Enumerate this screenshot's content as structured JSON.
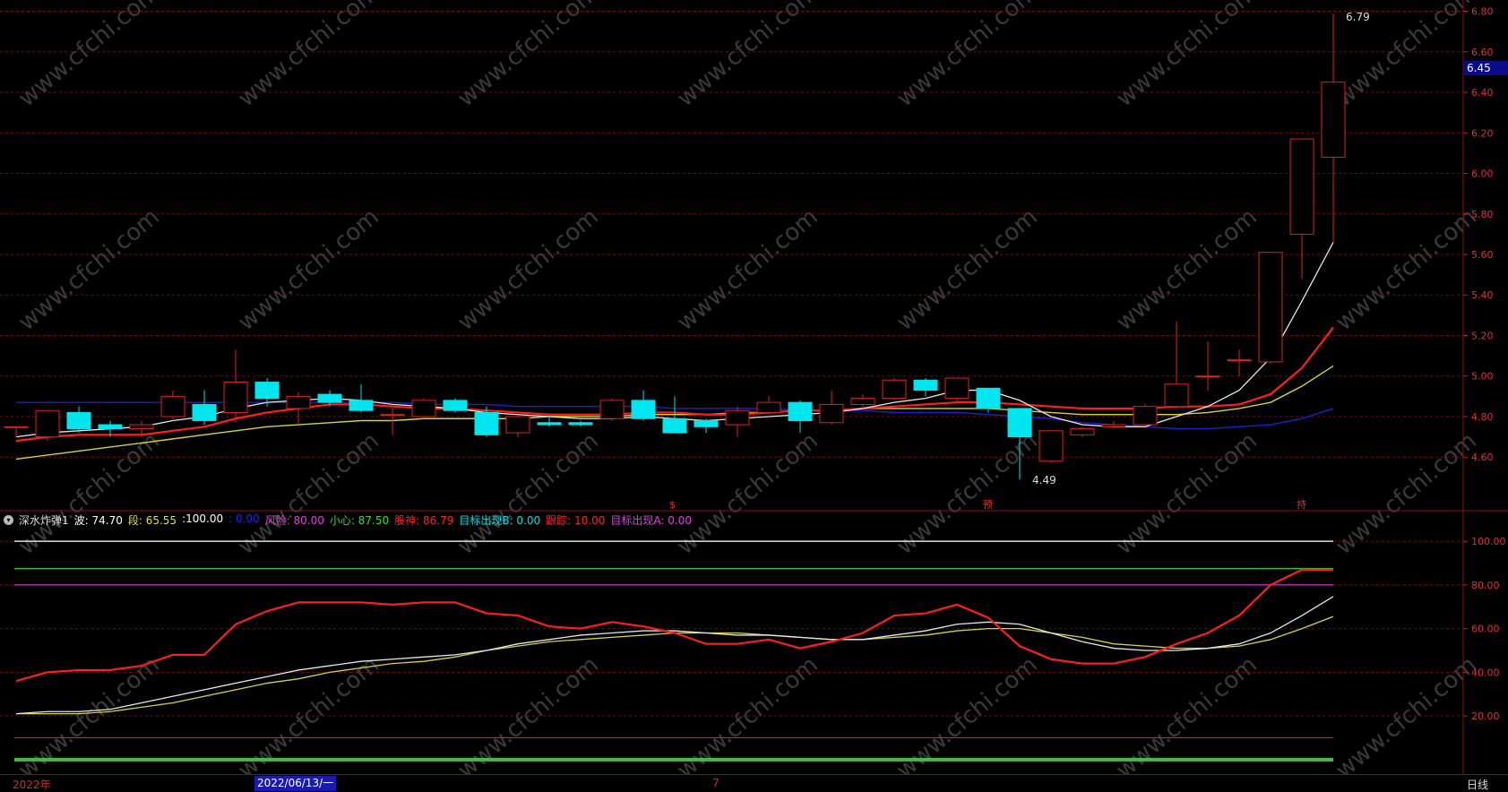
{
  "colors": {
    "up": "#e02020",
    "down": "#00e5ee",
    "ma_white": "#e6e6e6",
    "ma_red": "#ff1e1e",
    "ma_yellow": "#d6d62a",
    "ma_blue": "#2020d0",
    "grid": "#6e0f0f",
    "axis_text": "#e03030",
    "watermark": "#3a3a3a"
  },
  "watermark_text": "www.cfchi.com",
  "price_axis": {
    "ticks": [
      "6.80",
      "6.60",
      "6.40",
      "6.20",
      "6.00",
      "5.80",
      "5.60",
      "5.40",
      "5.20",
      "5.00",
      "4.80",
      "4.60"
    ],
    "range": [
      4.38,
      6.82
    ],
    "current_price": "6.45"
  },
  "annotations": {
    "high_label": "6.79",
    "low_label": "4.49",
    "signals": [
      "$",
      "预",
      "持"
    ]
  },
  "indicator_legend": {
    "name": "深水炸弹1",
    "items": [
      {
        "label": "波:",
        "value": "74.70",
        "color": "#ffffff"
      },
      {
        "label": "段:",
        "value": "65.55",
        "color": "#e0e040"
      },
      {
        "label": "",
        "value": ":100.00",
        "color": "#ffffff"
      },
      {
        "label": "",
        "value": ": 0.00",
        "color": "#2020ff"
      },
      {
        "label": "风险:",
        "value": "80.00",
        "color": "#e040e0"
      },
      {
        "label": "小心:",
        "value": "87.50",
        "color": "#30e030"
      },
      {
        "label": "股神:",
        "value": "86.79",
        "color": "#ff2020"
      },
      {
        "label": "目标出现B:",
        "value": "0.00",
        "color": "#00e0e0"
      },
      {
        "label": "跟踪:",
        "value": "10.00",
        "color": "#ff2020"
      },
      {
        "label": "目标出现A:",
        "value": "0.00",
        "color": "#e040e0"
      }
    ]
  },
  "indicator_axis": {
    "ticks": [
      "100.00",
      "80.00",
      "60.00",
      "40.00",
      "20.00"
    ],
    "range": [
      -5,
      105
    ]
  },
  "bottom_bar": {
    "year": "2022年",
    "date": "2022/06/13/一",
    "mark": "7",
    "period": "日线"
  },
  "chart_data": {
    "type": "candlestick",
    "candles": [
      {
        "o": 4.75,
        "c": 4.75,
        "h": 4.75,
        "l": 4.7
      },
      {
        "o": 4.7,
        "c": 4.83,
        "h": 4.83,
        "l": 4.68
      },
      {
        "o": 4.82,
        "c": 4.74,
        "h": 4.85,
        "l": 4.72
      },
      {
        "o": 4.76,
        "c": 4.74,
        "h": 4.78,
        "l": 4.7
      },
      {
        "o": 4.74,
        "c": 4.76,
        "h": 4.78,
        "l": 4.7
      },
      {
        "o": 4.8,
        "c": 4.9,
        "h": 4.93,
        "l": 4.78
      },
      {
        "o": 4.86,
        "c": 4.78,
        "h": 4.93,
        "l": 4.76
      },
      {
        "o": 4.82,
        "c": 4.97,
        "h": 5.13,
        "l": 4.77
      },
      {
        "o": 4.97,
        "c": 4.89,
        "h": 4.99,
        "l": 4.85
      },
      {
        "o": 4.84,
        "c": 4.9,
        "h": 4.92,
        "l": 4.76
      },
      {
        "o": 4.91,
        "c": 4.87,
        "h": 4.93,
        "l": 4.85
      },
      {
        "o": 4.88,
        "c": 4.83,
        "h": 4.96,
        "l": 4.82
      },
      {
        "o": 4.81,
        "c": 4.81,
        "h": 4.84,
        "l": 4.71
      },
      {
        "o": 4.8,
        "c": 4.88,
        "h": 4.89,
        "l": 4.79
      },
      {
        "o": 4.88,
        "c": 4.83,
        "h": 4.89,
        "l": 4.82
      },
      {
        "o": 4.82,
        "c": 4.71,
        "h": 4.85,
        "l": 4.7
      },
      {
        "o": 4.72,
        "c": 4.8,
        "h": 4.81,
        "l": 4.7
      },
      {
        "o": 4.77,
        "c": 4.76,
        "h": 4.8,
        "l": 4.75
      },
      {
        "o": 4.77,
        "c": 4.76,
        "h": 4.78,
        "l": 4.75
      },
      {
        "o": 4.79,
        "c": 4.88,
        "h": 4.89,
        "l": 4.78
      },
      {
        "o": 4.88,
        "c": 4.79,
        "h": 4.93,
        "l": 4.78
      },
      {
        "o": 4.79,
        "c": 4.72,
        "h": 4.9,
        "l": 4.72
      },
      {
        "o": 4.78,
        "c": 4.75,
        "h": 4.79,
        "l": 4.72
      },
      {
        "o": 4.76,
        "c": 4.83,
        "h": 4.85,
        "l": 4.7
      },
      {
        "o": 4.82,
        "c": 4.87,
        "h": 4.9,
        "l": 4.81
      },
      {
        "o": 4.87,
        "c": 4.78,
        "h": 4.88,
        "l": 4.72
      },
      {
        "o": 4.77,
        "c": 4.86,
        "h": 4.93,
        "l": 4.76
      },
      {
        "o": 4.86,
        "c": 4.89,
        "h": 4.91,
        "l": 4.84
      },
      {
        "o": 4.89,
        "c": 4.98,
        "h": 4.99,
        "l": 4.88
      },
      {
        "o": 4.98,
        "c": 4.93,
        "h": 4.99,
        "l": 4.9
      },
      {
        "o": 4.89,
        "c": 4.99,
        "h": 4.99,
        "l": 4.87
      },
      {
        "o": 4.94,
        "c": 4.84,
        "h": 4.94,
        "l": 4.82
      },
      {
        "o": 4.84,
        "c": 4.7,
        "h": 4.84,
        "l": 4.49
      },
      {
        "o": 4.58,
        "c": 4.73,
        "h": 4.73,
        "l": 4.57
      },
      {
        "o": 4.71,
        "c": 4.74,
        "h": 4.75,
        "l": 4.7
      },
      {
        "o": 4.75,
        "c": 4.76,
        "h": 4.78,
        "l": 4.74
      },
      {
        "o": 4.76,
        "c": 4.85,
        "h": 4.86,
        "l": 4.75
      },
      {
        "o": 4.85,
        "c": 4.96,
        "h": 5.27,
        "l": 4.84
      },
      {
        "o": 5.0,
        "c": 5.0,
        "h": 5.17,
        "l": 4.93
      },
      {
        "o": 5.08,
        "c": 5.08,
        "h": 5.13,
        "l": 5.0
      },
      {
        "o": 5.07,
        "c": 5.61,
        "h": 5.61,
        "l": 5.06
      },
      {
        "o": 5.7,
        "c": 6.17,
        "h": 6.17,
        "l": 5.48
      },
      {
        "o": 6.08,
        "c": 6.45,
        "h": 6.79,
        "l": 5.66
      }
    ],
    "ma_white": [
      4.7,
      4.72,
      4.73,
      4.74,
      4.75,
      4.78,
      4.8,
      4.84,
      4.87,
      4.88,
      4.89,
      4.88,
      4.86,
      4.85,
      4.84,
      4.82,
      4.81,
      4.8,
      4.79,
      4.79,
      4.8,
      4.79,
      4.78,
      4.79,
      4.8,
      4.81,
      4.82,
      4.84,
      4.87,
      4.89,
      4.93,
      4.93,
      4.88,
      4.8,
      4.76,
      4.75,
      4.75,
      4.8,
      4.85,
      4.93,
      5.09,
      5.37,
      5.66
    ],
    "ma_red": [
      4.68,
      4.7,
      4.71,
      4.71,
      4.71,
      4.73,
      4.75,
      4.79,
      4.82,
      4.84,
      4.86,
      4.86,
      4.85,
      4.84,
      4.84,
      4.83,
      4.82,
      4.81,
      4.81,
      4.81,
      4.82,
      4.82,
      4.81,
      4.81,
      4.82,
      4.83,
      4.83,
      4.84,
      4.85,
      4.86,
      4.87,
      4.87,
      4.86,
      4.85,
      4.84,
      4.84,
      4.84,
      4.85,
      4.85,
      4.86,
      4.91,
      5.04,
      5.24
    ],
    "ma_yellow": [
      4.59,
      4.61,
      4.63,
      4.65,
      4.67,
      4.69,
      4.71,
      4.73,
      4.75,
      4.76,
      4.77,
      4.78,
      4.78,
      4.79,
      4.79,
      4.79,
      4.79,
      4.8,
      4.8,
      4.8,
      4.81,
      4.81,
      4.81,
      4.82,
      4.82,
      4.83,
      4.83,
      4.84,
      4.84,
      4.84,
      4.84,
      4.84,
      4.83,
      4.82,
      4.81,
      4.81,
      4.81,
      4.81,
      4.82,
      4.84,
      4.87,
      4.95,
      5.05
    ],
    "ma_blue": [
      4.87,
      4.87,
      4.87,
      4.87,
      4.87,
      4.87,
      4.87,
      4.87,
      4.87,
      4.87,
      4.87,
      4.87,
      4.87,
      4.86,
      4.86,
      4.86,
      4.85,
      4.85,
      4.85,
      4.85,
      4.85,
      4.84,
      4.84,
      4.84,
      4.84,
      4.83,
      4.83,
      4.83,
      4.82,
      4.82,
      4.82,
      4.81,
      4.8,
      4.79,
      4.77,
      4.76,
      4.75,
      4.74,
      4.74,
      4.75,
      4.76,
      4.79,
      4.84
    ],
    "indicator_lines": {
      "red": [
        36,
        40,
        41,
        41,
        43,
        48,
        48,
        62,
        68,
        72,
        72,
        72,
        71,
        72,
        72,
        67,
        66,
        61,
        60,
        63,
        61,
        58,
        53,
        53,
        55,
        51,
        54,
        58,
        66,
        67,
        71,
        65,
        52,
        46,
        44,
        44,
        47,
        53,
        58,
        66,
        80,
        87,
        87
      ],
      "white": [
        21,
        22,
        22,
        23,
        26,
        29,
        32,
        35,
        38,
        41,
        43,
        45,
        46,
        47,
        48,
        50,
        53,
        55,
        57,
        58,
        59,
        59,
        58,
        57,
        57,
        56,
        55,
        55,
        57,
        59,
        62,
        63,
        62,
        58,
        54,
        51,
        50,
        50,
        51,
        53,
        58,
        66,
        74.7
      ],
      "yellow": [
        21,
        21,
        21,
        22,
        24,
        26,
        29,
        32,
        35,
        37,
        40,
        42,
        44,
        45,
        47,
        50,
        52,
        54,
        55,
        56,
        57,
        58,
        58,
        58,
        57,
        56,
        55,
        55,
        56,
        57,
        59,
        60,
        60,
        58,
        56,
        53,
        52,
        51,
        51,
        52,
        55,
        60,
        65.55
      ]
    },
    "indicator_levels": {
      "white": 100,
      "green": 87.5,
      "magenta": 80,
      "red": 10,
      "green_bottom": 0
    }
  }
}
